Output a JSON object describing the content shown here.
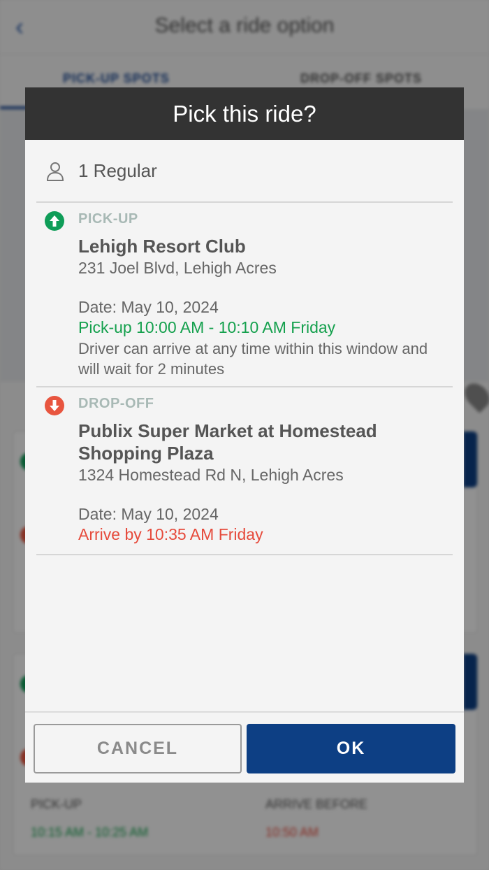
{
  "background": {
    "header_title": "Select a ride option",
    "back_icon": "chevron-left-icon",
    "tabs": [
      {
        "label": "PICK-UP SPOTS"
      },
      {
        "label": "DROP-OFF SPOTS"
      }
    ],
    "footer_pickup_label": "PICK-UP",
    "footer_pickup_time": "10:15 AM - 10:25 AM",
    "footer_arrive_label": "ARRIVE BEFORE",
    "footer_arrive_time": "10:50 AM"
  },
  "dialog": {
    "title": "Pick this ride?",
    "passengers": {
      "icon": "person-icon",
      "text": "1 Regular"
    },
    "pickup": {
      "icon": "arrow-up-circle-icon",
      "label": "PICK-UP",
      "name": "Lehigh Resort Club",
      "address": "231 Joel Blvd, Lehigh Acres",
      "date": "Date: May 10, 2024",
      "window": "Pick-up 10:00 AM - 10:10 AM Friday",
      "note": "Driver can arrive at any time within this window and will wait for 2 minutes"
    },
    "dropoff": {
      "icon": "arrow-down-circle-icon",
      "label": "DROP-OFF",
      "name": "Publix Super Market at Homestead Shopping Plaza",
      "address": "1324 Homestead Rd N, Lehigh Acres",
      "date": "Date: May 10, 2024",
      "arrive": "Arrive by 10:35 AM Friday"
    },
    "buttons": {
      "cancel": "CANCEL",
      "ok": "OK"
    },
    "colors": {
      "header_bg": "#333333",
      "pickup_green": "#14a04d",
      "dropoff_red": "#e64a3b",
      "ok_blue": "#0d3f84"
    }
  }
}
